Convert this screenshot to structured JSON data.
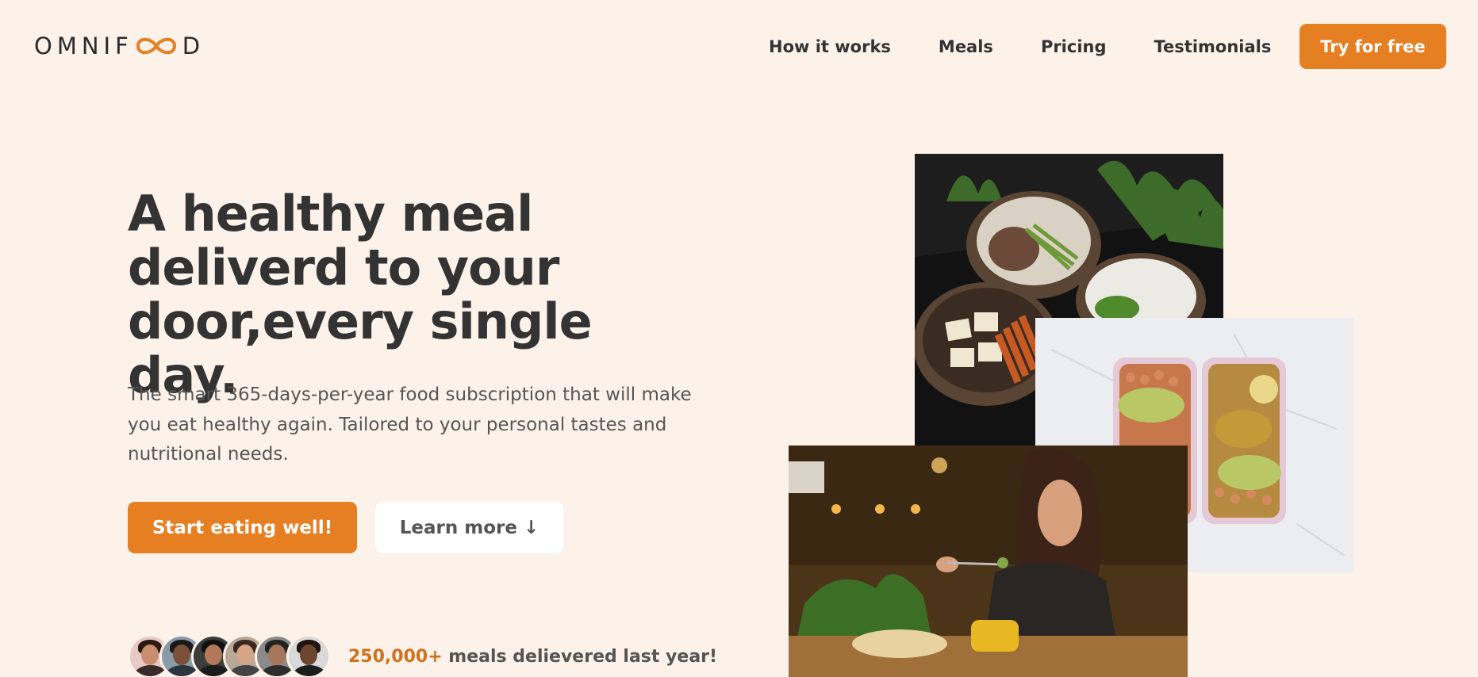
{
  "header": {
    "logo_text_left": "OMNIF",
    "logo_text_right": "D",
    "nav": [
      "How it works",
      "Meals",
      "Pricing",
      "Testimonials"
    ],
    "cta_label": "Try for free"
  },
  "hero": {
    "title_lines": [
      "A healthy meal",
      "deliverd to your",
      "door,every single day."
    ],
    "description": "The smart 365-days-per-year food subscription that will make you eat healthy again. Tailored to your personal tastes and nutritional needs.",
    "primary_button": "Start eating well!",
    "secondary_button": "Learn more ↓",
    "delivered_number": "250,000+",
    "delivered_text": " meals delievered last year!"
  },
  "colors": {
    "accent": "#e67e22",
    "background": "#fdf2e9",
    "text": "#333333"
  },
  "images": [
    {
      "name": "bowls-meal-image"
    },
    {
      "name": "meal-prep-boxes-image"
    },
    {
      "name": "woman-eating-image"
    }
  ]
}
